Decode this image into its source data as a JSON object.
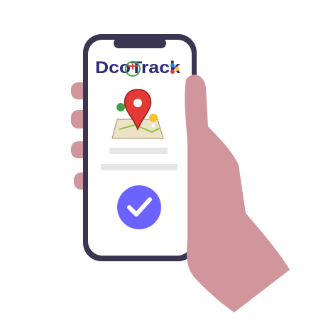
{
  "logo": {
    "text_prefix": "Dco",
    "text_suffix": "Track",
    "brand_color": "#2e2a7a",
    "accent_colors": [
      "#1e88e5",
      "#e53935",
      "#43a047",
      "#fbc02d"
    ]
  },
  "illustration": {
    "hand_color": "#d1959c",
    "phone_frame_color": "#3a3551",
    "screen_color": "#ffffff",
    "pin_color": "#e53935",
    "map_color": "#ede3c4",
    "placeholder_color": "#e6e6e6"
  },
  "confirm": {
    "icon": "checkmark-icon",
    "color": "#6c63ff"
  }
}
